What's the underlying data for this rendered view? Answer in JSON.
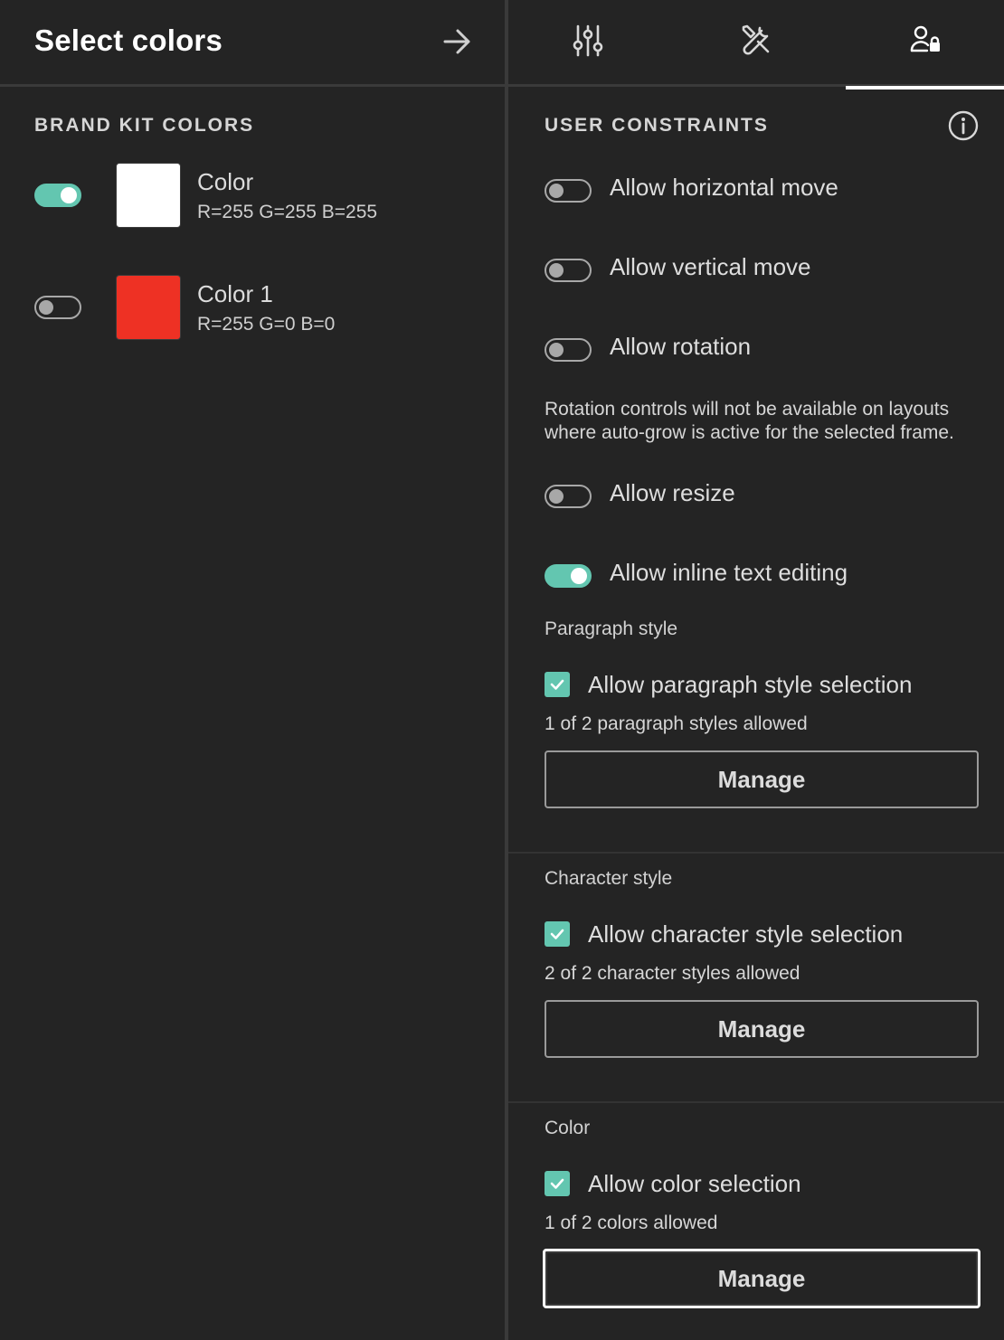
{
  "left": {
    "title": "Select colors",
    "section_title": "BRAND KIT COLORS",
    "colors": [
      {
        "name": "Color",
        "value": "R=255 G=255 B=255",
        "hex": "#ffffff",
        "enabled": true
      },
      {
        "name": "Color 1",
        "value": "R=255 G=0 B=0",
        "hex": "#ee3124",
        "enabled": false
      }
    ]
  },
  "right": {
    "tabs": [
      {
        "icon": "sliders-icon",
        "active": false
      },
      {
        "icon": "tools-icon",
        "active": false
      },
      {
        "icon": "user-lock-icon",
        "active": true
      }
    ],
    "section_title": "USER CONSTRAINTS",
    "toggles": [
      {
        "label": "Allow horizontal move",
        "enabled": false
      },
      {
        "label": "Allow vertical move",
        "enabled": false
      },
      {
        "label": "Allow rotation",
        "enabled": false
      },
      {
        "label": "Allow resize",
        "enabled": false
      },
      {
        "label": "Allow inline text editing",
        "enabled": true
      }
    ],
    "rotation_note": "Rotation controls will not be available on layouts where auto-grow is active for the selected frame.",
    "paragraph": {
      "heading": "Paragraph style",
      "checkbox_label": "Allow paragraph style selection",
      "count": "1 of 2 paragraph styles allowed",
      "button": "Manage"
    },
    "character": {
      "heading": "Character style",
      "checkbox_label": "Allow character style selection",
      "count": "2 of 2 character styles allowed",
      "button": "Manage"
    },
    "color": {
      "heading": "Color",
      "checkbox_label": "Allow color selection",
      "count": "1 of 2 colors allowed",
      "button": "Manage"
    }
  },
  "theme": {
    "accent": "#63c6b0",
    "background": "#242424",
    "divider": "#3a3a3a"
  }
}
